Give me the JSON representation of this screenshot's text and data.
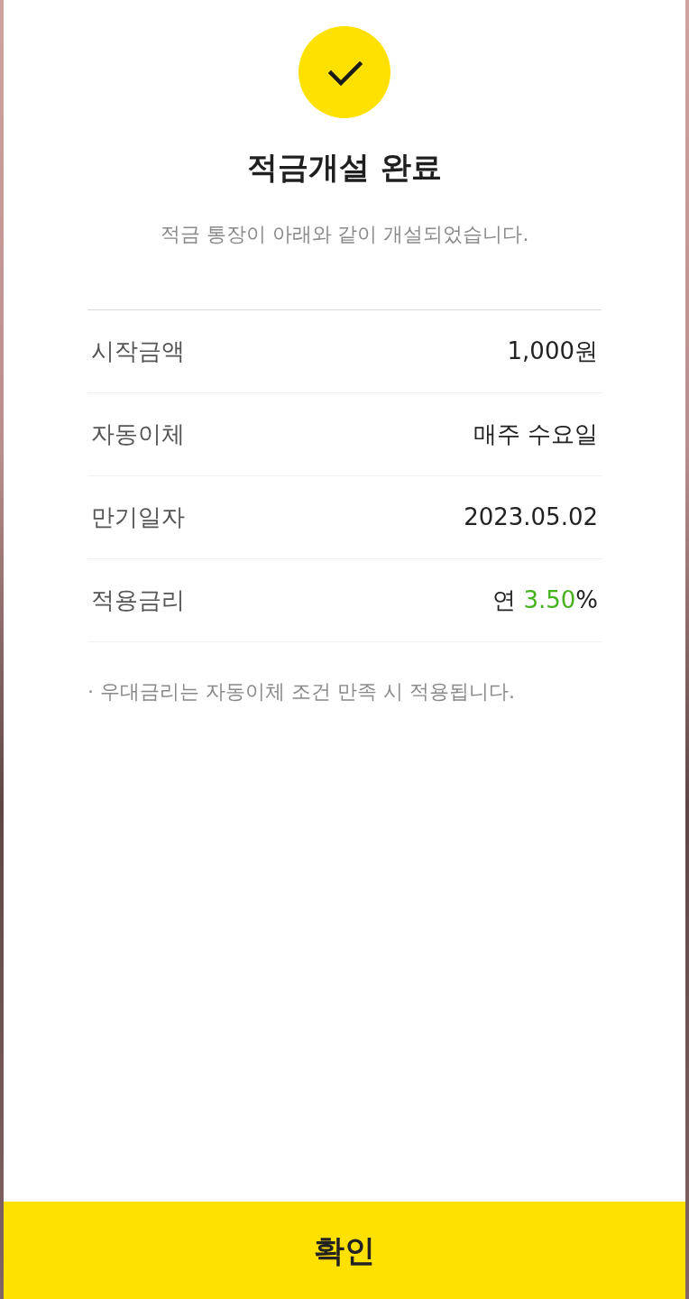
{
  "header": {
    "title": "적금개설 완료",
    "subtitle": "적금 통장이 아래와 같이 개설되었습니다."
  },
  "details": [
    {
      "label": "시작금액",
      "value": [
        {
          "text": "1,000원",
          "kind": "plain"
        }
      ]
    },
    {
      "label": "자동이체",
      "value": [
        {
          "text": "매주 수요일",
          "kind": "plain"
        }
      ]
    },
    {
      "label": "만기일자",
      "value": [
        {
          "text": "2023.05.02",
          "kind": "plain"
        }
      ]
    },
    {
      "label": "적용금리",
      "value": [
        {
          "text": "연 ",
          "kind": "plain"
        },
        {
          "text": "3.50",
          "kind": "highlight"
        },
        {
          "text": "%",
          "kind": "plain"
        }
      ]
    }
  ],
  "note": "· 우대금리는 자동이체 조건 만족 시 적용됩니다.",
  "confirm_button": {
    "label": "확인"
  }
}
